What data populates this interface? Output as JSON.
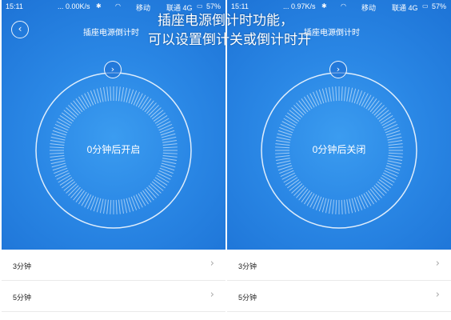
{
  "caption": {
    "line1": "插座电源倒计时功能，",
    "line2": "可以设置倒计关或倒计时开"
  },
  "left": {
    "status": {
      "time": "15:11",
      "net": "... 0.00K/s",
      "carrier": "移动",
      "carrier2": "联通 4G",
      "battery": "57%"
    },
    "title": "插座电源倒计时",
    "dial_text": "0分钟后开启",
    "list": [
      {
        "label": "3分钟"
      },
      {
        "label": "5分钟"
      }
    ]
  },
  "right": {
    "status": {
      "time": "15:11",
      "net": "... 0.97K/s",
      "carrier": "移动",
      "carrier2": "联通 4G",
      "battery": "57%"
    },
    "title": "插座电源倒计时",
    "dial_text": "0分钟后关闭",
    "list": [
      {
        "label": "3分钟"
      },
      {
        "label": "5分钟"
      }
    ]
  },
  "colors": {
    "accent": "#2a87e5",
    "divider": "#e9e9e9"
  },
  "icons": [
    "back-chevron-icon",
    "next-chevron-icon",
    "right-chevron-icon",
    "bluetooth-icon",
    "wifi-icon",
    "battery-icon"
  ]
}
